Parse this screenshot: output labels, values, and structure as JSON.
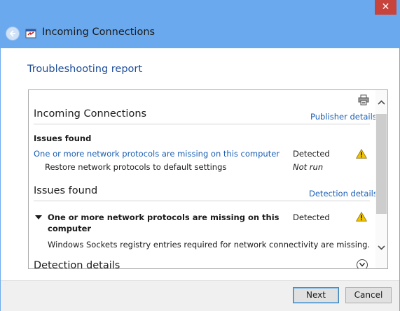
{
  "window": {
    "close_glyph": "✕"
  },
  "nav": {
    "title": "Incoming Connections",
    "back_icon": "back-arrow-icon",
    "app_icon": "troubleshooter-icon"
  },
  "content": {
    "heading": "Troubleshooting report",
    "report": {
      "section_title": "Incoming Connections",
      "publisher_link": "Publisher details",
      "issues_summary_title": "Issues found",
      "issue_link": "One or more network protocols are missing on this computer",
      "issue_status": "Detected",
      "fix_label": "Restore network protocols to default settings",
      "fix_status": "Not run",
      "issues_section_title": "Issues found",
      "detection_link": "Detection details",
      "issue_detail_title_line1": "One or more network protocols are missing on this",
      "issue_detail_title_line2": "computer",
      "issue_detail_status": "Detected",
      "issue_detail_description": "Windows Sockets registry entries required for network connectivity are missing.",
      "next_section_title": "Detection details"
    }
  },
  "footer": {
    "next_label": "Next",
    "cancel_label": "Cancel"
  },
  "colors": {
    "titlebar": "#6aa9ee",
    "heading": "#1e4e9a",
    "link": "#1a5fb4",
    "warning": "#f2c500",
    "close": "#c7443d"
  }
}
